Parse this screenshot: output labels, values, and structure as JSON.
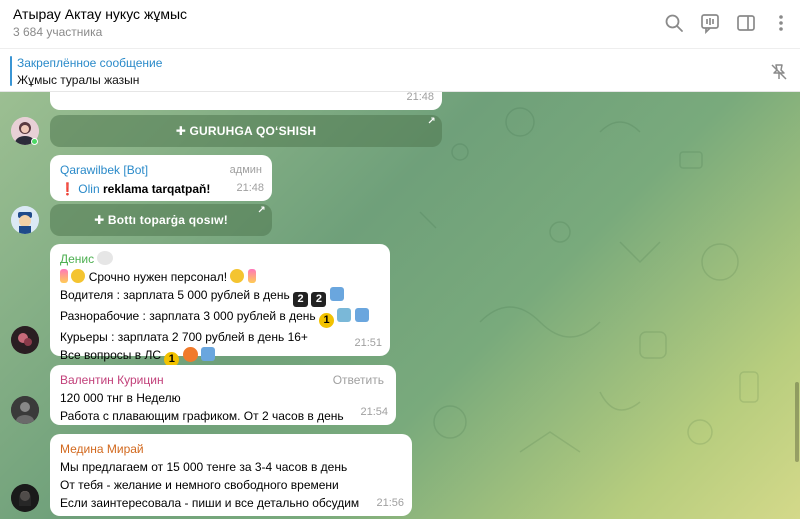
{
  "header": {
    "title": "Атырау Актау нукус жұмыс",
    "members": "3 684 участника"
  },
  "pinned": {
    "title": "Закреплённое сообщение",
    "text": "Жұмыс туралы жазын"
  },
  "messages": {
    "m0": {
      "time": "21:48",
      "button": "✚ GURUHGA QO‘SHISH"
    },
    "m1": {
      "sender": "Qarawilbek [Bot]",
      "role": "админ",
      "mention": "Olin",
      "text": "reklama tarqatpaň!",
      "time": "21:48",
      "button": "✚ Bottı toparġa qosıw!"
    },
    "m2": {
      "sender": "Денис",
      "line1": "Срочно нужен персонал!",
      "line2": "Водителя : зарплата 5 000 рублей в день",
      "line3": "Разнорабочие :  зарплата 3 000 рублей в день",
      "line4": "Курьеры : зарплата 2 700 рублей в день 16+",
      "line5": "Все вопросы в ЛС",
      "time": "21:51"
    },
    "m3": {
      "sender": "Валентин Курицин",
      "reply": "Ответить",
      "line1": "120 000 тнг в Неделю",
      "line2": "Работа с плавающим графиком. От 2 часов в день",
      "time": "21:54"
    },
    "m4": {
      "sender": "Медина Мирай",
      "line1": "Мы предлагаем от 15 000 тенге за 3-4 часов в день",
      "line2": "От тебя - желание и немного свободного времени",
      "line3": "Если заинтересовала - пиши и все детально обсудим",
      "time": "21:56"
    }
  },
  "colors": {
    "pinned_accent": "#2a8ac9",
    "bot_name": "#2a8ac9",
    "denis_name": "#4caf50",
    "valentin_name": "#c2407a",
    "medina_name": "#d2691e"
  },
  "icons": [
    "search-icon",
    "video-chat-icon",
    "sidebar-icon",
    "more-icon",
    "unpin-icon"
  ]
}
